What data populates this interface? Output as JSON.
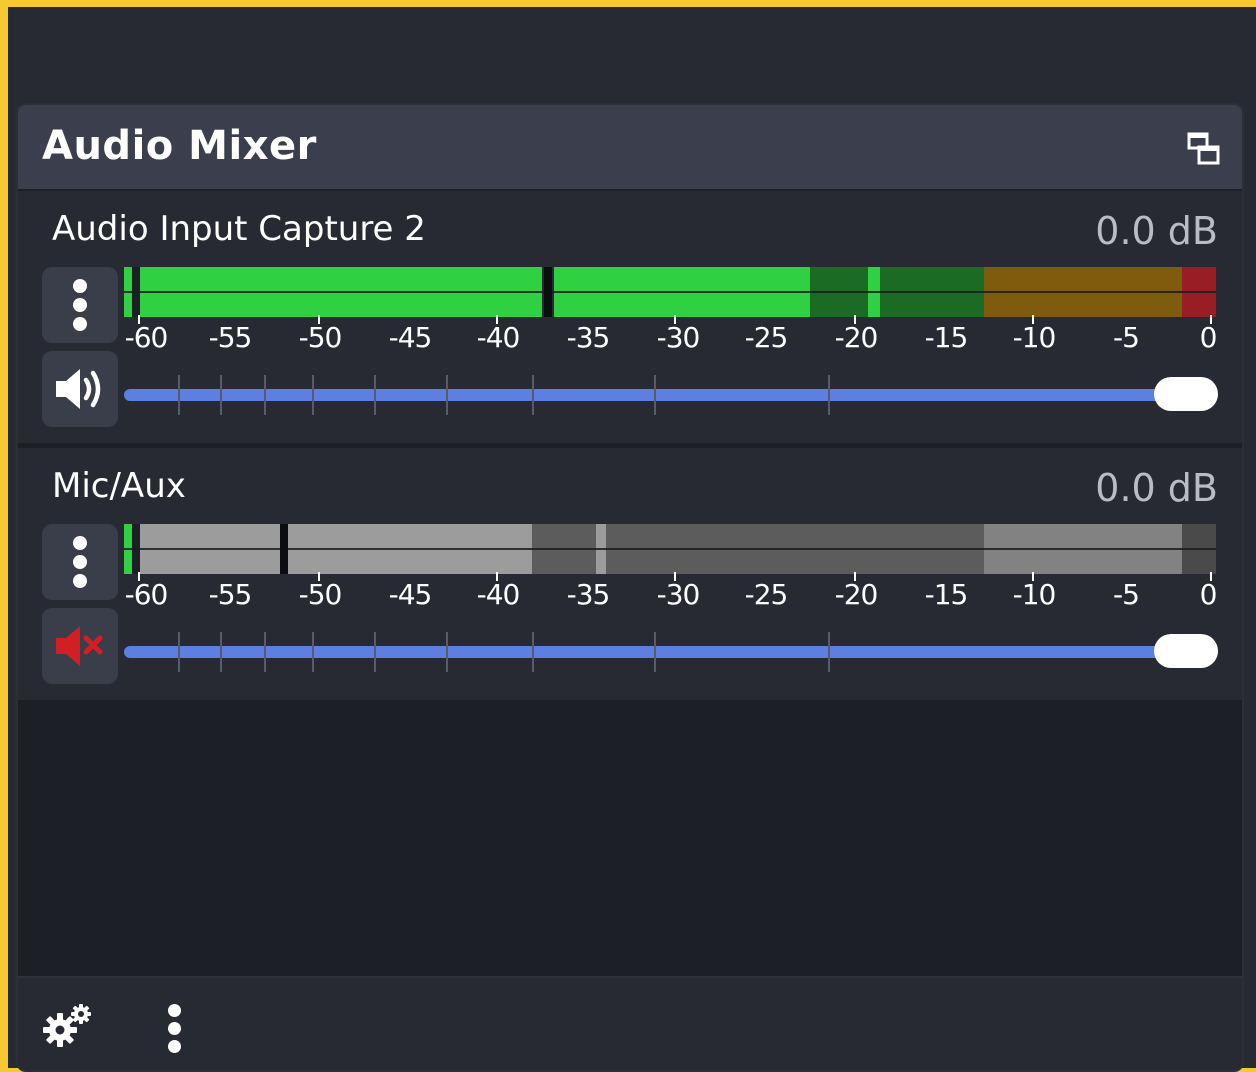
{
  "dock": {
    "title": "Audio Mixer",
    "undock_icon": "float-window-icon"
  },
  "channels": [
    {
      "name": "Audio Input Capture 2",
      "volume_db": "0.0 dB",
      "muted": false,
      "mute_icon": "speaker-icon",
      "menu_icon": "vertical-dots-icon",
      "fader_position": 1.0
    },
    {
      "name": "Mic/Aux",
      "volume_db": "0.0 dB",
      "muted": true,
      "mute_icon": "speaker-muted-icon",
      "menu_icon": "vertical-dots-icon",
      "fader_position": 1.0
    }
  ],
  "meter_scale": [
    "-60",
    "-55",
    "-50",
    "-45",
    "-40",
    "-35",
    "-30",
    "-25",
    "-20",
    "-15",
    "-10",
    "-5",
    "0"
  ],
  "footer": {
    "settings_icon": "gear-icon",
    "menu_icon": "vertical-dots-icon"
  },
  "colors": {
    "meter_green": "#2fd042",
    "meter_green_dim": "#1b6b25",
    "meter_yellow_dim": "#7f5b0d",
    "meter_red_dim": "#981d24",
    "meter_muted_light": "#9c9c9c",
    "meter_muted_dark": "#5c5c5c",
    "fader": "#5d7fe2",
    "mute_red": "#d11f24",
    "window_border": "#f7c931"
  }
}
